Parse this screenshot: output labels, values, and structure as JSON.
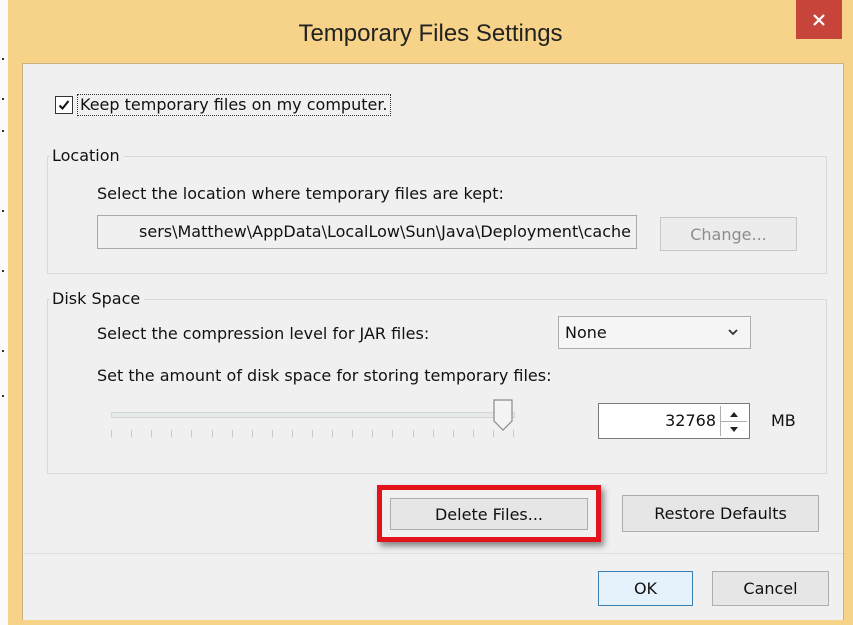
{
  "window": {
    "title": "Temporary Files Settings"
  },
  "keep_files": {
    "label": "Keep temporary files on my computer.",
    "checked": true
  },
  "location": {
    "group_title": "Location",
    "description": "Select the location where temporary files are kept:",
    "path_value": "sers\\Matthew\\AppData\\LocalLow\\Sun\\Java\\Deployment\\cache",
    "change_label": "Change..."
  },
  "disk_space": {
    "group_title": "Disk Space",
    "compression_label": "Select the compression level for JAR files:",
    "compression_value": "None",
    "space_label": "Set the amount of disk space for storing temporary files:",
    "amount_value": "32768",
    "unit": "MB",
    "slider_level": 1.0
  },
  "actions": {
    "delete_label": "Delete Files...",
    "restore_label": "Restore Defaults"
  },
  "footer": {
    "ok_label": "OK",
    "cancel_label": "Cancel"
  },
  "colors": {
    "frame": "#f7d389",
    "close": "#c7443a",
    "highlight": "#e3131b"
  },
  "icons": {
    "close": "close-icon",
    "check": "checkmark-icon",
    "dropdown": "chevron-down-icon"
  }
}
